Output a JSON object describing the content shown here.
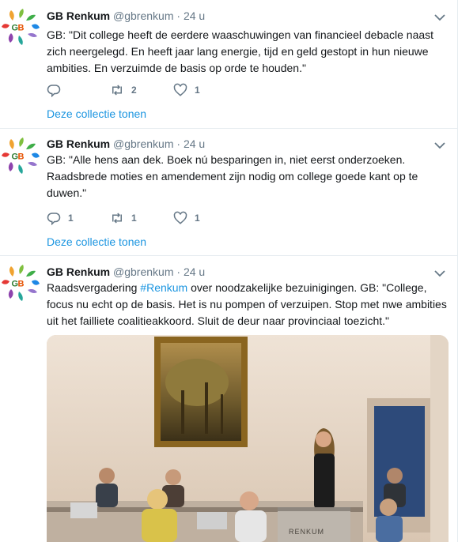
{
  "account": {
    "name": "GB Renkum",
    "handle": "@gbrenkum",
    "separator": "·"
  },
  "tweets": [
    {
      "time": "24 u",
      "text": "GB: \"Dit college heeft de eerdere waaschuwingen van financieel debacle naast zich neergelegd. En heeft jaar lang energie, tijd en geld gestopt in hun nieuwe ambities. En verzuimde de basis op orde te houden.\"",
      "replies": "",
      "retweets": "2",
      "likes": "1",
      "collection": "Deze collectie tonen"
    },
    {
      "time": "24 u",
      "text": "GB: \"Alle hens aan dek. Boek nú besparingen in, niet eerst onderzoeken. Raadsbrede moties en amendement zijn nodig om college goede kant op te duwen.\"",
      "replies": "1",
      "retweets": "1",
      "likes": "1",
      "collection": "Deze collectie tonen"
    },
    {
      "time": "24 u",
      "text_before": "Raadsvergadering ",
      "hashtag": "#Renkum",
      "text_after": " over noodzakelijke bezuinigingen. GB: \"College, focus nu echt op de basis. Het is nu pompen of verzuipen. Stop met nwe ambities uit het failliete coalitieakkoord. Sluit de deur naar provinciaal toezicht.\"",
      "podium_label": "RENKUM"
    }
  ],
  "icons": {
    "avatar": "gb-logo-icon",
    "menu": "chevron-down-icon",
    "reply": "reply-icon",
    "retweet": "retweet-icon",
    "like": "heart-icon"
  },
  "colors": {
    "link": "#1b95e0",
    "muted": "#657786",
    "text": "#14171a",
    "divider": "#e6ecf0"
  }
}
